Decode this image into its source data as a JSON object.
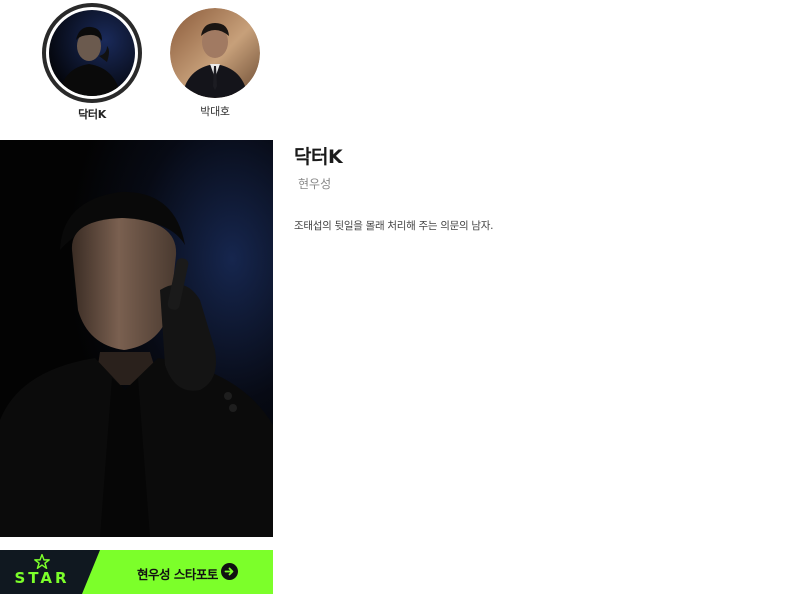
{
  "characters": [
    {
      "name": "닥터K",
      "selected": true
    },
    {
      "name": "박대호",
      "selected": false
    }
  ],
  "detail": {
    "title": "닥터K",
    "actor": "현우성",
    "description": "조태섭의 뒷일을 몰래 처리해 주는 의문의 남자."
  },
  "star_banner": {
    "logo_text": "STAR",
    "cta_label": "현우성 스타포토",
    "icon": "arrow-right-icon",
    "colors": {
      "dark": "#101820",
      "accent": "#7cff2a"
    }
  }
}
